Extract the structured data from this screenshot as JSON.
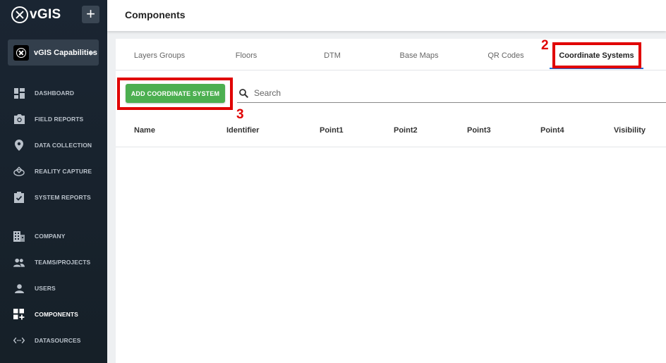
{
  "app": {
    "logo_text": "vGIS",
    "capabilities_label": "vGIS Capabilities"
  },
  "sidebar": {
    "items": [
      {
        "label": "DASHBOARD",
        "icon": "dashboard-icon"
      },
      {
        "label": "FIELD REPORTS",
        "icon": "camera-icon"
      },
      {
        "label": "DATA COLLECTION",
        "icon": "map-pin-icon"
      },
      {
        "label": "REALITY CAPTURE",
        "icon": "reality-capture-icon"
      },
      {
        "label": "SYSTEM REPORTS",
        "icon": "clipboard-check-icon"
      },
      {
        "label": "COMPANY",
        "icon": "building-icon"
      },
      {
        "label": "TEAMS/PROJECTS",
        "icon": "people-icon"
      },
      {
        "label": "USERS",
        "icon": "person-icon"
      },
      {
        "label": "COMPONENTS",
        "icon": "components-add-icon",
        "active": true
      },
      {
        "label": "DATASOURCES",
        "icon": "code-arrows-icon"
      }
    ]
  },
  "header": {
    "title": "Components"
  },
  "tabs": [
    {
      "label": "Layers Groups"
    },
    {
      "label": "Floors"
    },
    {
      "label": "DTM"
    },
    {
      "label": "Base Maps"
    },
    {
      "label": "QR Codes"
    },
    {
      "label": "Coordinate Systems",
      "active": true
    }
  ],
  "toolbar": {
    "add_label": "ADD COORDINATE SYSTEM",
    "search_placeholder": "Search"
  },
  "table": {
    "columns": [
      "Name",
      "Identifier",
      "Point1",
      "Point2",
      "Point3",
      "Point4",
      "Visibility"
    ],
    "rows": []
  },
  "annotations": {
    "tab_number": "2",
    "button_number": "3"
  },
  "colors": {
    "sidebar_bg": "#1a2532",
    "accent_blue": "#1e6fd9",
    "add_button_green": "#4caf50",
    "annotation_red": "#e00000"
  }
}
